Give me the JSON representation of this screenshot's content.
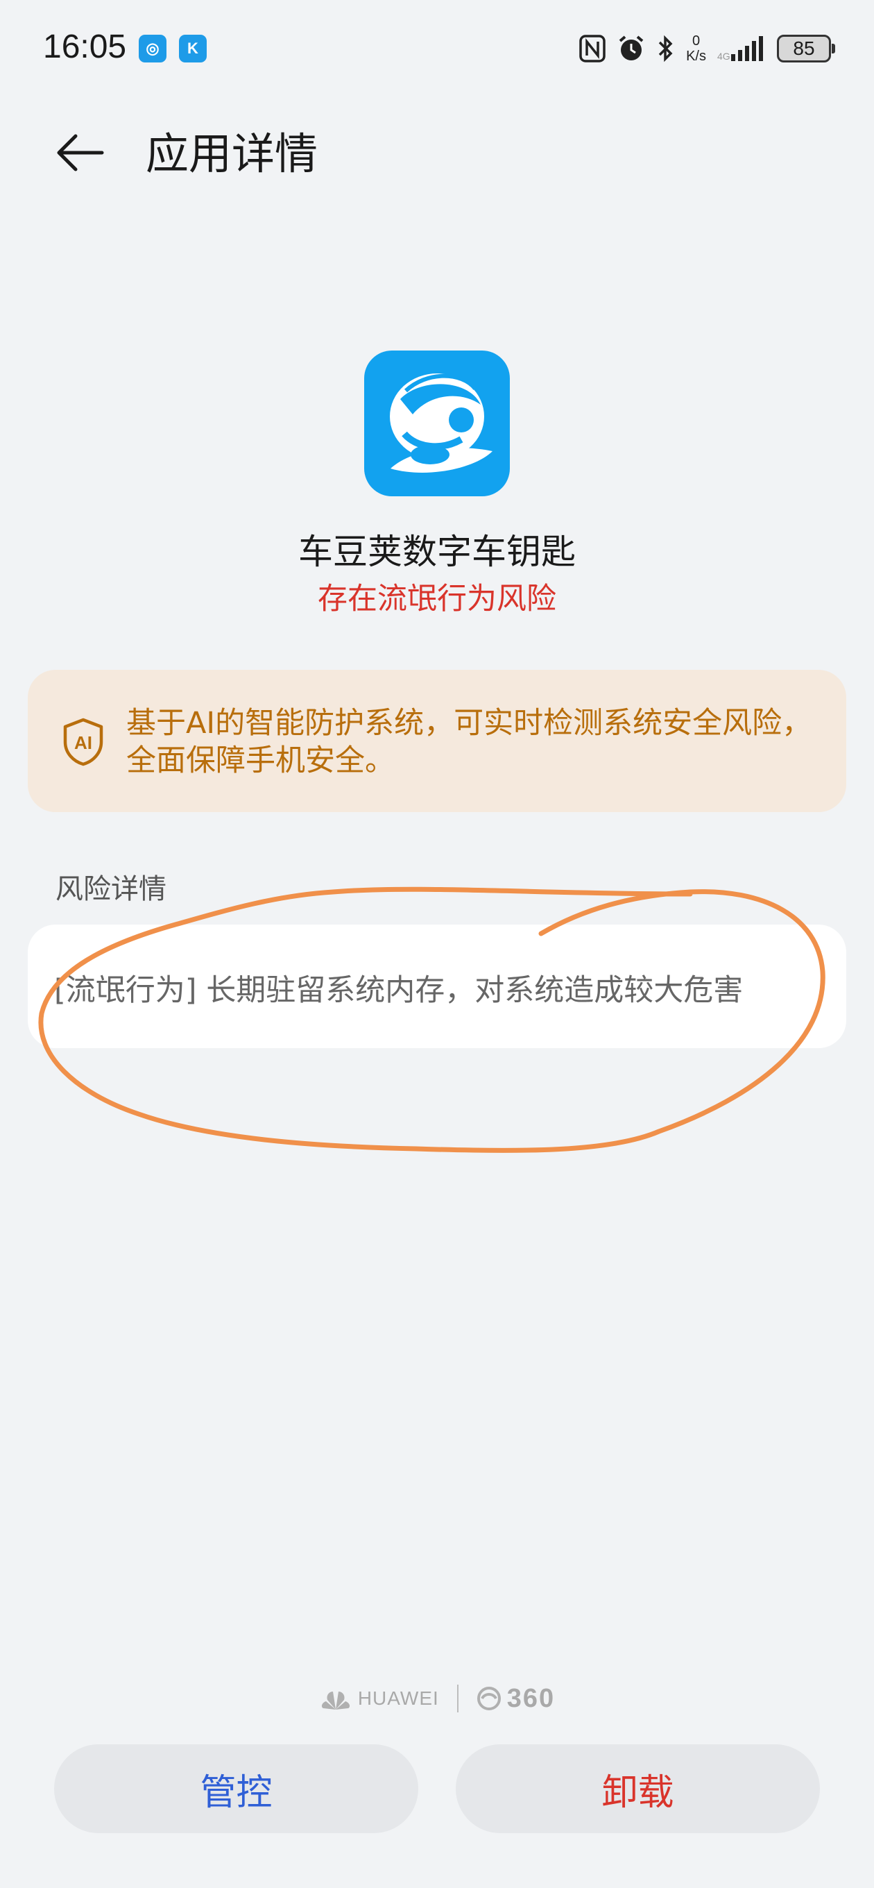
{
  "status_bar": {
    "time": "16:05",
    "left_icons": [
      "app-notification-icon-1",
      "app-notification-icon-2"
    ],
    "net_speed_value": "0",
    "net_speed_unit": "K/s",
    "battery_level": "85",
    "right_icons": [
      "nfc-icon",
      "alarm-icon",
      "bluetooth-icon",
      "signal-icon",
      "battery-icon"
    ]
  },
  "header": {
    "back_icon": "back-arrow-icon",
    "title": "应用详情"
  },
  "app": {
    "icon": "car-key-app-icon",
    "name": "车豆荚数字车钥匙",
    "risk_status": "存在流氓行为风险"
  },
  "ai_banner": {
    "icon": "ai-shield-icon",
    "text": "基于AI的智能防护系统，可实时检测系统安全风险，全面保障手机安全。"
  },
  "risk_section": {
    "label": "风险详情",
    "items": [
      {
        "text": "[流氓行为] 长期驻留系统内存，对系统造成较大危害"
      }
    ]
  },
  "footer": {
    "brand_huawei": "HUAWEI",
    "brand_360": "360",
    "control_button": "管控",
    "uninstall_button": "卸载"
  },
  "colors": {
    "background": "#f1f3f5",
    "risk_red": "#d9342b",
    "banner_bg": "#f5e9dd",
    "banner_text": "#b86e0c",
    "control_blue": "#2f5fd6",
    "annotation_orange": "#f0904a",
    "app_icon_blue": "#12a2ef"
  }
}
